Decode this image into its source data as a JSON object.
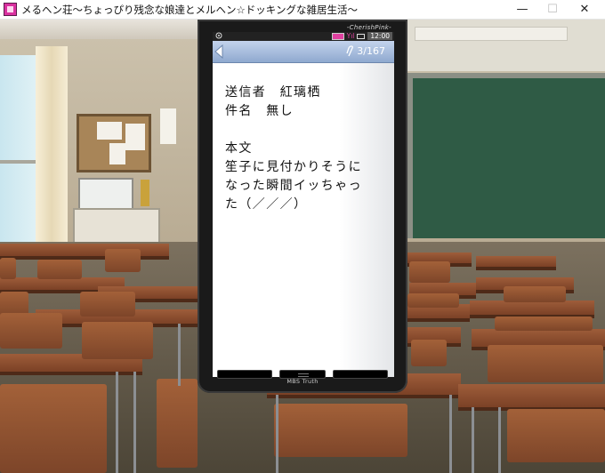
{
  "window": {
    "title": "メるヘン荘～ちょっぴり残念な娘達とメルヘン☆ドッキングな雑居生活～",
    "controls": {
      "minimize": "—",
      "maximize": "☐",
      "close": "✕"
    }
  },
  "phone": {
    "brand": "-CherishPink-",
    "status": {
      "signal_label": "Yıl",
      "clock": "12:00"
    },
    "header": {
      "counter": "3/167"
    },
    "message": {
      "sender_line": "送信者　紅璃栖",
      "subject_line": "件名　無し",
      "body_label": "本文",
      "body_lines": [
        "笙子に見付かりそうに",
        "なった瞬間イッちゃっ",
        "た（／／／）"
      ]
    },
    "model_label": "MBS Truth"
  },
  "colors": {
    "header_blue": "#8fa9cf",
    "phone_body": "#1a1a1a",
    "battery_pink": "#e040a0",
    "app_icon": "#d9319f"
  },
  "icons": {
    "app": "app-icon",
    "back": "back-arrow-icon",
    "attachment": "paperclip-icon",
    "battery": "battery-icon",
    "mail": "mail-icon",
    "settings": "settings-icon"
  }
}
